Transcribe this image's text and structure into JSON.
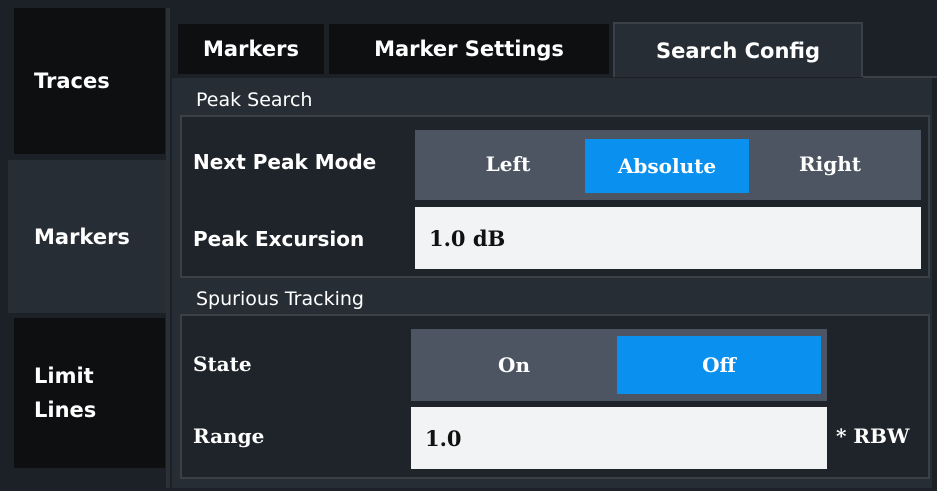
{
  "side_nav": {
    "traces": "Traces",
    "markers": "Markers",
    "limit_lines": "Limit\nLines"
  },
  "tabs": [
    {
      "label": "Markers",
      "active": false
    },
    {
      "label": "Marker Settings",
      "active": false
    },
    {
      "label": "Search Config",
      "active": true
    }
  ],
  "peak_search": {
    "section_label": "Peak Search",
    "next_peak_mode": {
      "label": "Next Peak Mode",
      "options": [
        "Left",
        "Absolute",
        "Right"
      ],
      "selected": "Absolute"
    },
    "peak_excursion": {
      "label": "Peak Excursion",
      "value": "1.0 dB"
    }
  },
  "spurious_tracking": {
    "section_label": "Spurious Tracking",
    "state": {
      "label": "State",
      "options": [
        "On",
        "Off"
      ],
      "selected": "Off"
    },
    "range": {
      "label": "Range",
      "value": "1.0",
      "unit": "* RBW"
    }
  },
  "colors": {
    "background": "#1c2127",
    "panel": "#272d34",
    "selected_accent": "#0a90ee",
    "segment_bg": "#4c5561",
    "input_bg": "#f2f3f4"
  }
}
